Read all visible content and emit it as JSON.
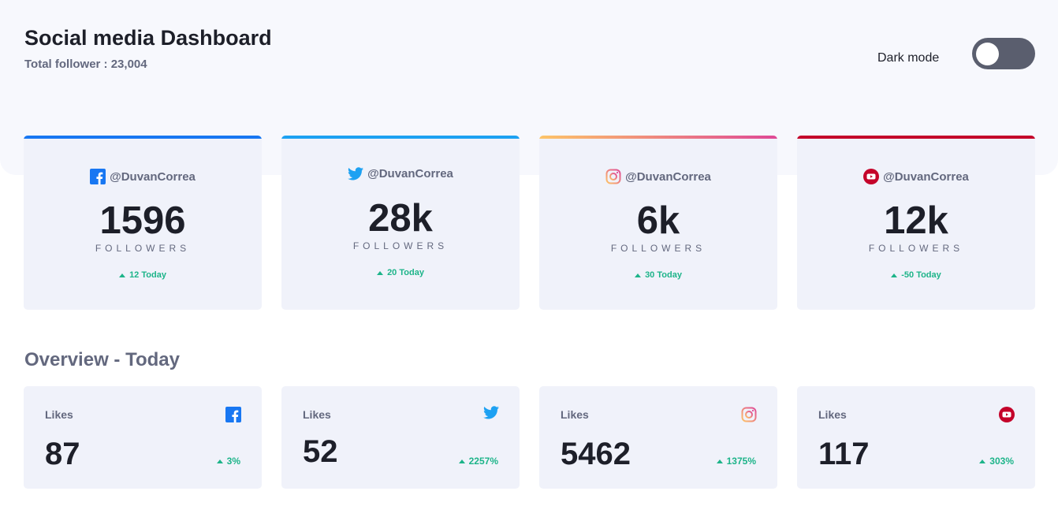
{
  "header": {
    "title": "Social media Dashboard",
    "total_followers": "Total follower : 23,004",
    "dark_mode_label": "Dark mode",
    "dark_mode_enabled": false
  },
  "colors": {
    "facebook": "#1877f2",
    "twitter": "#1da1f2",
    "instagram_start": "#fdc468",
    "instagram_end": "#df4996",
    "youtube": "#c4032a",
    "positive": "#1db489"
  },
  "follower_cards": [
    {
      "network": "facebook",
      "icon": "facebook-icon",
      "handle": "@DuvanCorrea",
      "count": "1596",
      "unit": "FOLLOWERS",
      "today": "12 Today"
    },
    {
      "network": "twitter",
      "icon": "twitter-icon",
      "handle": "@DuvanCorrea",
      "count": "28k",
      "unit": "FOLLOWERS",
      "today": "20 Today"
    },
    {
      "network": "instagram",
      "icon": "instagram-icon",
      "handle": "@DuvanCorrea",
      "count": "6k",
      "unit": "FOLLOWERS",
      "today": "30 Today"
    },
    {
      "network": "youtube",
      "icon": "youtube-icon",
      "handle": "@DuvanCorrea",
      "count": "12k",
      "unit": "FOLLOWERS",
      "today": "-50 Today"
    }
  ],
  "overview": {
    "title": "Overview - Today",
    "cards": [
      {
        "network": "facebook",
        "icon": "facebook-icon",
        "metric": "Likes",
        "value": "87",
        "change": "3%"
      },
      {
        "network": "twitter",
        "icon": "twitter-icon",
        "metric": "Likes",
        "value": "52",
        "change": "2257%"
      },
      {
        "network": "instagram",
        "icon": "instagram-icon",
        "metric": "Likes",
        "value": "5462",
        "change": "1375%"
      },
      {
        "network": "youtube",
        "icon": "youtube-icon",
        "metric": "Likes",
        "value": "117",
        "change": "303%"
      }
    ]
  }
}
